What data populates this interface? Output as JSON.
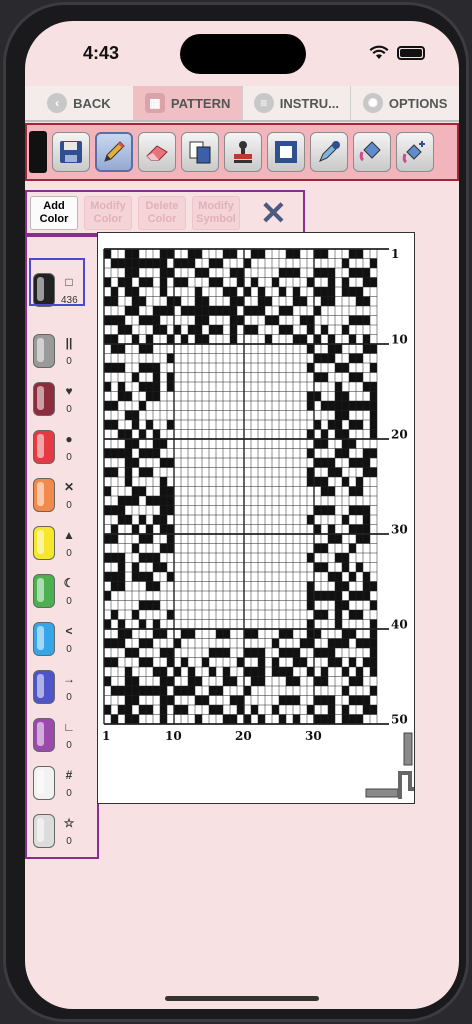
{
  "status": {
    "time": "4:43"
  },
  "nav": {
    "back": "BACK",
    "pattern": "PATTERN",
    "instructions": "INSTRU...",
    "options": "OPTIONS"
  },
  "actions": {
    "add_color": "Add Color",
    "modify_color": "Modify Color",
    "delete_color": "Delete Color",
    "modify_symbol": "Modify Symbol"
  },
  "palette": [
    {
      "color": "#222222",
      "symbol": "□",
      "count": "436",
      "selected": true
    },
    {
      "color": "#9a9a9a",
      "symbol": "||",
      "count": "0"
    },
    {
      "color": "#8c2c3c",
      "symbol": "♥",
      "count": "0"
    },
    {
      "color": "#e53a43",
      "symbol": "●",
      "count": "0"
    },
    {
      "color": "#f18a4c",
      "symbol": "✕",
      "count": "0"
    },
    {
      "color": "#f6e72a",
      "symbol": "▲",
      "count": "0"
    },
    {
      "color": "#4caf50",
      "symbol": "☾",
      "count": "0"
    },
    {
      "color": "#35a7e8",
      "symbol": "<",
      "count": "0"
    },
    {
      "color": "#4d55c8",
      "symbol": "→",
      "count": "0"
    },
    {
      "color": "#9a4aad",
      "symbol": "∟",
      "count": "0"
    },
    {
      "color": "#f2f2f2",
      "symbol": "#",
      "count": "0"
    },
    {
      "color": "#dcdcdc",
      "symbol": "☆",
      "count": "0"
    }
  ],
  "chart": {
    "cols": 39,
    "rows": 50,
    "row_labels": [
      "1",
      "10",
      "20",
      "30",
      "40",
      "50"
    ],
    "col_labels": [
      "1",
      "10",
      "20",
      "30"
    ]
  }
}
